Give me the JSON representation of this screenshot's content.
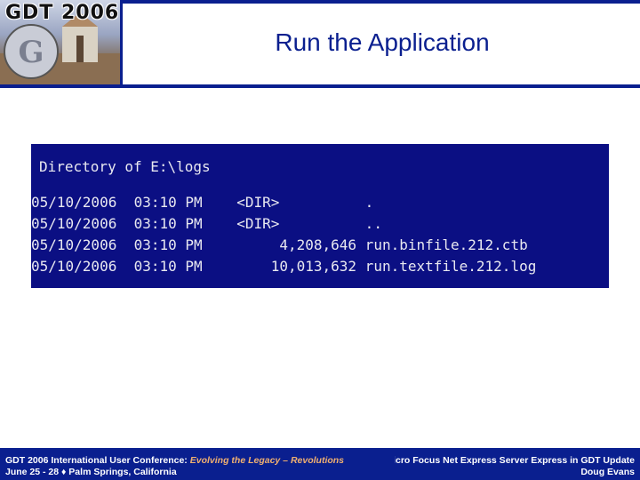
{
  "logo": {
    "text": "GDT 2006"
  },
  "slide": {
    "title": "Run the Application"
  },
  "terminal": {
    "heading": "Directory of E:\\logs",
    "rows": [
      "05/10/2006  03:10 PM    <DIR>          .",
      "05/10/2006  03:10 PM    <DIR>          ..",
      "05/10/2006  03:10 PM         4,208,646 run.binfile.212.ctb",
      "05/10/2006  03:10 PM        10,013,632 run.textfile.212.log"
    ]
  },
  "footer": {
    "conference": "GDT 2006 International User Conference: ",
    "theme": "Evolving the Legacy – Revolutions",
    "dates": "June 25 - 28  ♦  Palm Springs, California",
    "session": "Micro Focus Net Express Server Express in GDT Update",
    "presenter": "Doug Evans"
  },
  "colors": {
    "brand_blue": "#0a1f8f",
    "terminal_bg": "#0b0f83",
    "accent": "#f0b070"
  }
}
